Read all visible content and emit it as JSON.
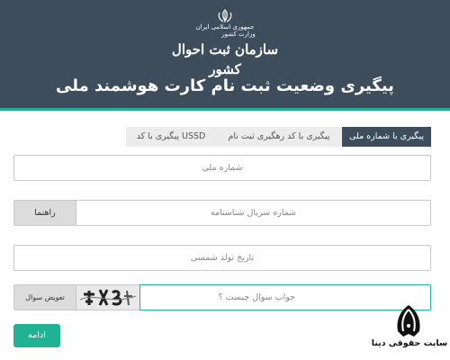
{
  "header": {
    "logo": {
      "line1": "جمهوری اسلامی ایران",
      "line2": "وزارت کشور",
      "line3": "سازمان ثبت احوال کشور"
    },
    "title": "پیگیری وضعیت ثبت نام کارت هوشمند ملی",
    "background_color": "#3d4d5c",
    "accent_color": "#1fb394"
  },
  "tabs": [
    {
      "label": "پیگیری با شماره ملی",
      "active": true
    },
    {
      "label": "پیگیری با کد رهگیری ثبت نام",
      "active": false
    },
    {
      "label": "پیگیری با کد USSD",
      "active": false
    }
  ],
  "form": {
    "national_code_placeholder": "شماره ملی",
    "serial_placeholder": "شماره سریال شناسنامه",
    "help_button": "راهنما",
    "birthdate_placeholder": "تاریخ تولد شمسی",
    "captcha_question_placeholder": "جواب سوال چیست ؟",
    "change_question_button": "تعویض سوال",
    "submit_button": "ادامه"
  },
  "watermark": {
    "text": "سایت حقوقی دینا"
  }
}
